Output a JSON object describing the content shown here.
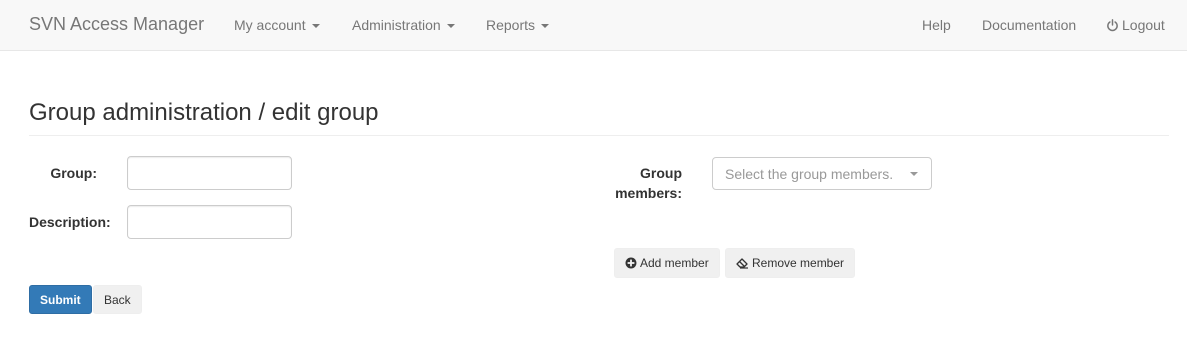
{
  "navbar": {
    "brand": "SVN Access Manager",
    "menus": [
      {
        "label": "My account"
      },
      {
        "label": "Administration"
      },
      {
        "label": "Reports"
      }
    ],
    "right_links": [
      {
        "label": "Help"
      },
      {
        "label": "Documentation"
      },
      {
        "label": "Logout",
        "icon": "power-icon"
      }
    ],
    "colors": {
      "background": "#f8f8f8",
      "text": "#777777"
    }
  },
  "page": {
    "title": "Group administration / edit group"
  },
  "form": {
    "group_label": "Group:",
    "group_value": "",
    "description_label": "Description:",
    "description_value": "",
    "members_label_line1": "Group",
    "members_label_line2": "members:",
    "members_placeholder": "Select the group members.",
    "add_member_label": "Add member",
    "add_member_icon": "plus-circle-icon",
    "remove_member_label": "Remove member",
    "remove_member_icon": "eraser-icon",
    "submit_label": "Submit",
    "back_label": "Back"
  },
  "colors": {
    "primary": "#337ab7",
    "default_button": "#f0f0f0"
  }
}
